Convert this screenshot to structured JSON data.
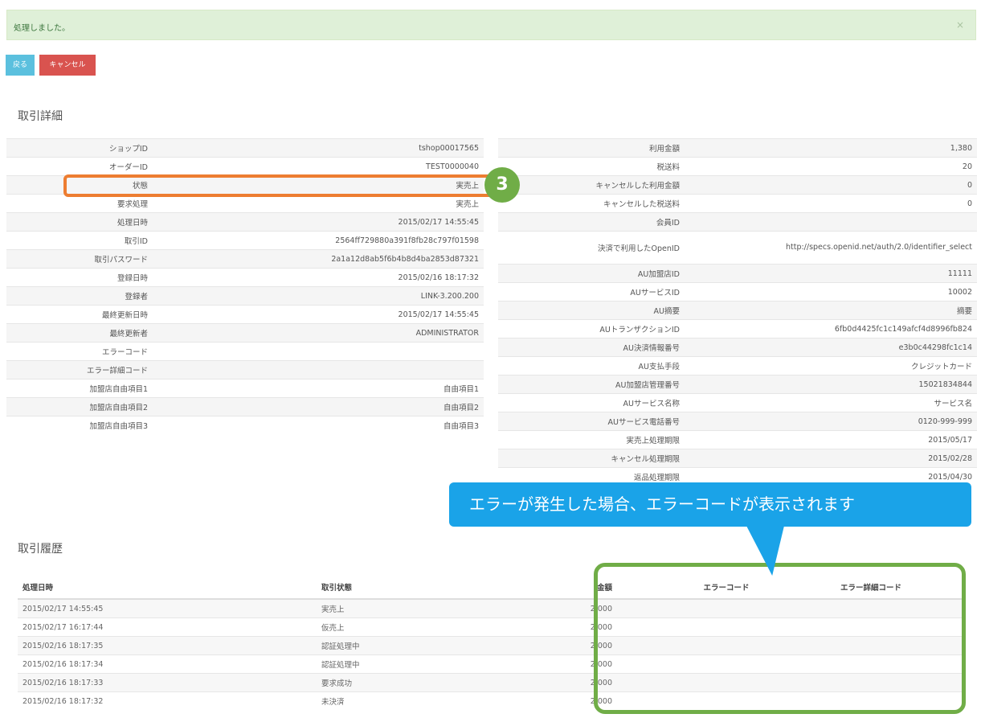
{
  "alert": {
    "message": "処理しました。",
    "close": "×"
  },
  "buttons": {
    "back": "戻る",
    "cancel": "キャンセル"
  },
  "detail": {
    "title": "取引詳細",
    "left_rows": [
      {
        "label": "ショップID",
        "value": "tshop00017565"
      },
      {
        "label": "オーダーID",
        "value": "TEST0000040"
      },
      {
        "label": "状態",
        "value": "実売上"
      },
      {
        "label": "要求処理",
        "value": "実売上"
      },
      {
        "label": "処理日時",
        "value": "2015/02/17 14:55:45"
      },
      {
        "label": "取引ID",
        "value": "2564ff729880a391f8fb28c797f01598"
      },
      {
        "label": "取引パスワード",
        "value": "2a1a12d8ab5f6b4b8d4ba2853d87321"
      },
      {
        "label": "登録日時",
        "value": "2015/02/16 18:17:32"
      },
      {
        "label": "登録者",
        "value": "LINK-3.200.200"
      },
      {
        "label": "最終更新日時",
        "value": "2015/02/17 14:55:45"
      },
      {
        "label": "最終更新者",
        "value": "ADMINISTRATOR"
      },
      {
        "label": "エラーコード",
        "value": ""
      },
      {
        "label": "エラー詳細コード",
        "value": ""
      },
      {
        "label": "加盟店自由項目1",
        "value": "自由項目1"
      },
      {
        "label": "加盟店自由項目2",
        "value": "自由項目2"
      },
      {
        "label": "加盟店自由項目3",
        "value": "自由項目3"
      }
    ],
    "right_rows": [
      {
        "label": "利用金額",
        "value": "1,380"
      },
      {
        "label": "税送料",
        "value": "20"
      },
      {
        "label": "キャンセルした利用金額",
        "value": "0"
      },
      {
        "label": "キャンセルした税送料",
        "value": "0"
      },
      {
        "label": "会員ID",
        "value": ""
      },
      {
        "label": "決済で利用したOpenID",
        "value": "http://specs.openid.net/auth/2.0/identifier_select"
      },
      {
        "label": "AU加盟店ID",
        "value": "11111"
      },
      {
        "label": "AUサービスID",
        "value": "10002"
      },
      {
        "label": "AU摘要",
        "value": "摘要"
      },
      {
        "label": "AUトランザクションID",
        "value": "6fb0d4425fc1c149afcf4d8996fb824"
      },
      {
        "label": "AU決済情報番号",
        "value": "e3b0c44298fc1c14"
      },
      {
        "label": "AU支払手段",
        "value": "クレジットカード"
      },
      {
        "label": "AU加盟店管理番号",
        "value": "15021834844"
      },
      {
        "label": "AUサービス名称",
        "value": "サービス名"
      },
      {
        "label": "AUサービス電話番号",
        "value": "0120-999-999"
      },
      {
        "label": "実売上処理期限",
        "value": "2015/05/17"
      },
      {
        "label": "キャンセル処理期限",
        "value": "2015/02/28"
      },
      {
        "label": "返品処理期限",
        "value": "2015/04/30"
      }
    ]
  },
  "history": {
    "title": "取引履歴",
    "columns": [
      "処理日時",
      "取引状態",
      "金額",
      "エラーコード",
      "エラー詳細コード"
    ],
    "rows": [
      [
        "2015/02/17 14:55:45",
        "実売上",
        "2,000",
        "",
        ""
      ],
      [
        "2015/02/17 16:17:44",
        "仮売上",
        "2,000",
        "",
        ""
      ],
      [
        "2015/02/16 18:17:35",
        "認証処理中",
        "2,000",
        "",
        ""
      ],
      [
        "2015/02/16 18:17:34",
        "認証処理中",
        "2,000",
        "",
        ""
      ],
      [
        "2015/02/16 18:17:33",
        "要求成功",
        "2,000",
        "",
        ""
      ],
      [
        "2015/02/16 18:17:32",
        "未決済",
        "2,000",
        "",
        ""
      ]
    ]
  },
  "annotations": {
    "badge": "3",
    "callout": "エラーが発生した場合、エラーコードが表示されます",
    "orange": "#ed7d31",
    "green": "#70ad47",
    "blue": "#1aa3e8"
  }
}
